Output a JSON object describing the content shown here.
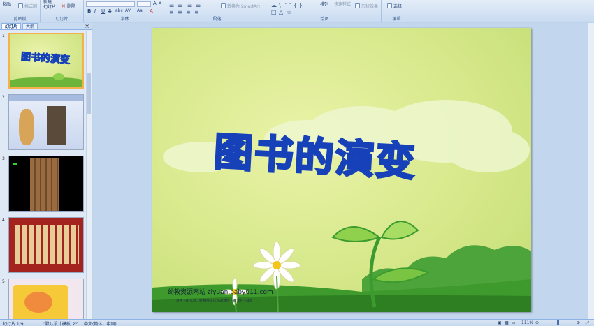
{
  "ribbon": {
    "clipboard": {
      "paste": "粘贴",
      "format_painter": "格式刷",
      "group": "剪贴板"
    },
    "slides": {
      "new_slide": "新建\n幻灯片",
      "delete": "删除",
      "group": "幻灯片"
    },
    "font": {
      "group": "字体",
      "font_size_up": "A",
      "font_size_down": "A",
      "bold": "B",
      "italic": "I",
      "underline": "U",
      "strike": "S",
      "shadow": "abc",
      "spacing": "AV",
      "case": "Aa",
      "color": "A"
    },
    "paragraph": {
      "group": "段落",
      "convert_smartart": "转换为 SmartArt"
    },
    "drawing": {
      "group": "绘图",
      "arrange": "排列",
      "quick_styles": "快速样式",
      "shape_effects": "形状效果"
    },
    "editing": {
      "group": "编辑",
      "select": "选择"
    }
  },
  "panel": {
    "tabs": [
      "幻灯片",
      "大纲"
    ],
    "close": "×",
    "slides": [
      {
        "num": "1",
        "title": "图书的演变"
      },
      {
        "num": "2"
      },
      {
        "num": "3"
      },
      {
        "num": "4"
      },
      {
        "num": "5"
      }
    ]
  },
  "slide": {
    "title": "图书的演变",
    "site": "幼教资源网站  ziyuan.baby611.com",
    "subline": "课件下载    儿歌、故事MP3    FLASH课件下载    试卷下载等"
  },
  "status": {
    "slide_count": "幻灯片 1/9",
    "theme": "\"默认设计模板_2\"",
    "language": "中文(简体，中国)",
    "zoom": "111%"
  },
  "colors": {
    "title_fill": "#38a7f2",
    "title_outline": "#1641b8",
    "selected_thumb": "#f6b24a"
  }
}
